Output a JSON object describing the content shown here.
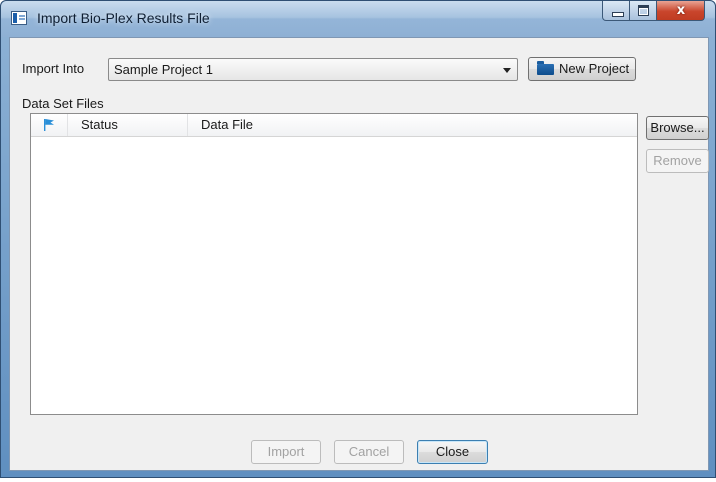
{
  "window": {
    "title": "Import Bio-Plex Results File",
    "controls": {
      "minimize": "minimize-icon",
      "maximize": "maximize-icon",
      "close": "x"
    }
  },
  "import_into": {
    "label": "Import Into",
    "selected": "Sample Project 1",
    "new_project_label": "New Project"
  },
  "data_set_files": {
    "label": "Data Set Files",
    "columns": [
      "",
      "Status",
      "Data File"
    ],
    "rows": [],
    "browse_label": "Browse...",
    "remove_label": "Remove"
  },
  "footer": {
    "import_label": "Import",
    "cancel_label": "Cancel",
    "close_label": "Close"
  },
  "colors": {
    "titlebar": "#a7c3e0",
    "close_button": "#c9452c",
    "flag_icon": "#2a8fd8",
    "folder_icon": "#0d4c8c"
  }
}
